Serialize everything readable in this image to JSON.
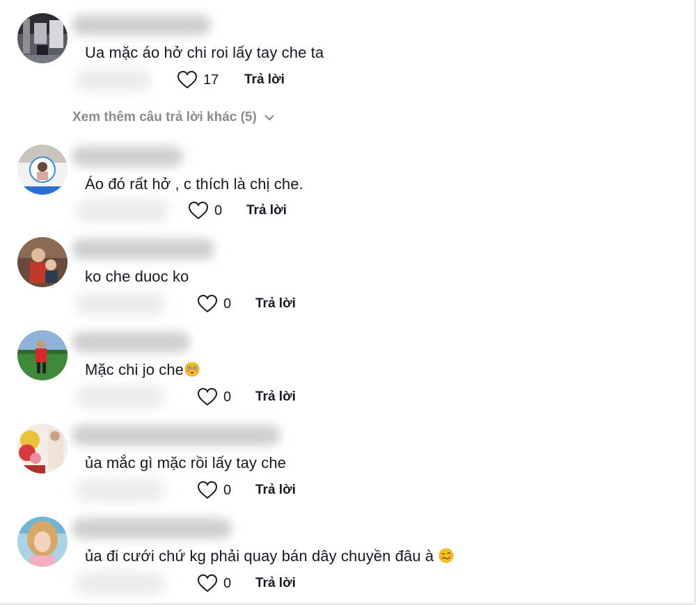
{
  "reply_label": "Trả lời",
  "view_more": {
    "label": "Xem thêm câu trả lời khác (5)"
  },
  "comments": [
    {
      "text": "Ua mặc áo hở chi roi lấy tay che ta",
      "likes": "17",
      "avatar_icon": "avatar-photo-store"
    },
    {
      "text": "Áo đó rất hở , c thích là chị che.",
      "likes": "0",
      "avatar_icon": "avatar-photo-woman"
    },
    {
      "text": "ko che duoc ko",
      "likes": "0",
      "avatar_icon": "avatar-photo-family"
    },
    {
      "text": "Mặc chi jo che",
      "likes": "0",
      "avatar_icon": "avatar-photo-football",
      "emoji": "flushed-face-emoji"
    },
    {
      "text": "ủa mắc gì mặc rồi lấy tay che",
      "likes": "0",
      "avatar_icon": "avatar-photo-flowers"
    },
    {
      "text": "ủa đi cưới chứ kg phải quay bán dây chuyền đâu à",
      "likes": "0",
      "avatar_icon": "avatar-photo-girl",
      "emoji": "woozy-face-emoji"
    }
  ],
  "colors": {
    "text": "#161823",
    "muted": "#8a8b91",
    "background": "#ffffff"
  }
}
